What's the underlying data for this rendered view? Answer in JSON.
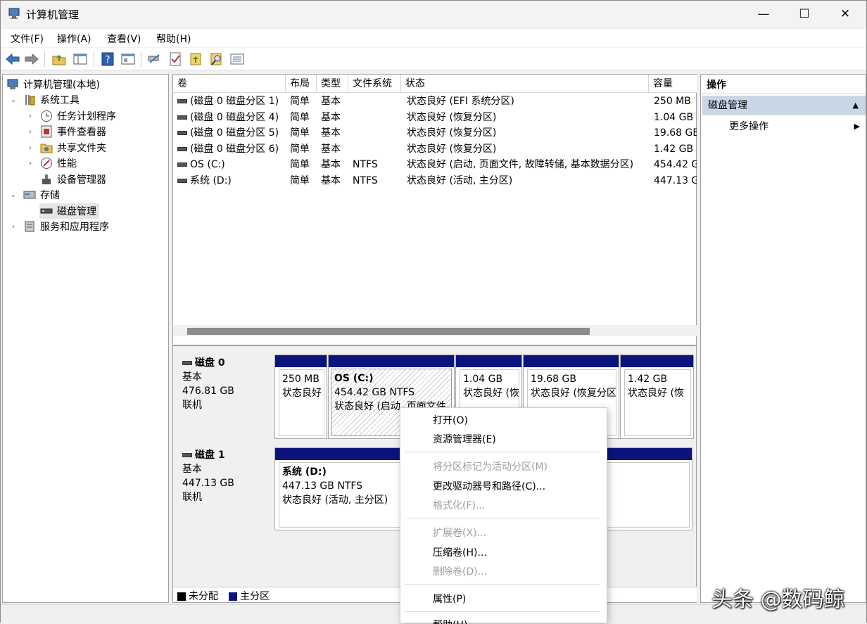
{
  "window": {
    "title": "计算机管理",
    "minimize": "—",
    "maximize": "☐",
    "close": "✕"
  },
  "menu": [
    "文件(F)",
    "操作(A)",
    "查看(V)",
    "帮助(H)"
  ],
  "toolbar": [
    "back-arrow-icon",
    "forward-arrow-icon",
    "folder-up-icon",
    "show-hide-tree-icon",
    "help-icon",
    "properties-icon",
    "connect-icon",
    "checklist-icon",
    "folder-arrow-icon",
    "search-folder-icon",
    "list-view-icon"
  ],
  "tree": {
    "root": "计算机管理(本地)",
    "system_tools": "系统工具",
    "task_scheduler": "任务计划程序",
    "event_viewer": "事件查看器",
    "shared_folders": "共享文件夹",
    "performance": "性能",
    "device_manager": "设备管理器",
    "storage": "存储",
    "disk_management": "磁盘管理",
    "services_apps": "服务和应用程序"
  },
  "volume_list": {
    "columns": [
      "卷",
      "布局",
      "类型",
      "文件系统",
      "状态",
      "容量"
    ],
    "rows": [
      [
        "(磁盘 0 磁盘分区 1)",
        "简单",
        "基本",
        "",
        "状态良好 (EFI 系统分区)",
        "250 MB"
      ],
      [
        "(磁盘 0 磁盘分区 4)",
        "简单",
        "基本",
        "",
        "状态良好 (恢复分区)",
        "1.04 GB"
      ],
      [
        "(磁盘 0 磁盘分区 5)",
        "简单",
        "基本",
        "",
        "状态良好 (恢复分区)",
        "19.68 GB"
      ],
      [
        "(磁盘 0 磁盘分区 6)",
        "简单",
        "基本",
        "",
        "状态良好 (恢复分区)",
        "1.42 GB"
      ],
      [
        "OS (C:)",
        "简单",
        "基本",
        "NTFS",
        "状态良好 (启动, 页面文件, 故障转储, 基本数据分区)",
        "454.42 G"
      ],
      [
        "系统 (D:)",
        "简单",
        "基本",
        "NTFS",
        "状态良好 (活动, 主分区)",
        "447.13 G"
      ]
    ]
  },
  "disk0": {
    "name": "磁盘 0",
    "type": "基本",
    "size": "476.81 GB",
    "status": "联机",
    "partitions": [
      {
        "title": "",
        "line1": "250 MB",
        "line2": "状态良好"
      },
      {
        "title": "OS (C:)",
        "line1": "454.42 GB NTFS",
        "line2": "状态良好 (启动, 页面文件"
      },
      {
        "title": "",
        "line1": "1.04 GB",
        "line2": "状态良好 (恢"
      },
      {
        "title": "",
        "line1": "19.68 GB",
        "line2": "状态良好 (恢复分区"
      },
      {
        "title": "",
        "line1": "1.42 GB",
        "line2": "状态良好 (恢"
      }
    ]
  },
  "disk1": {
    "name": "磁盘 1",
    "type": "基本",
    "size": "447.13 GB",
    "status": "联机",
    "partitions": [
      {
        "title": "系统 (D:)",
        "line1": "447.13 GB NTFS",
        "line2": "状态良好 (活动, 主分区)"
      }
    ]
  },
  "legend": {
    "unallocated": "未分配",
    "primary": "主分区",
    "unallocated_color": "#000000",
    "primary_color": "#0c137c"
  },
  "actions": {
    "header": "操作",
    "section": "磁盘管理",
    "more": "更多操作"
  },
  "context_menu": {
    "open": "打开(O)",
    "explore": "资源管理器(E)",
    "mark_active": "将分区标记为活动分区(M)",
    "change_letter": "更改驱动器号和路径(C)...",
    "format": "格式化(F)...",
    "extend": "扩展卷(X)...",
    "shrink": "压缩卷(H)...",
    "delete": "删除卷(D)...",
    "properties": "属性(P)",
    "help": "帮助(H)"
  },
  "watermark": "头条 @数码鲸"
}
